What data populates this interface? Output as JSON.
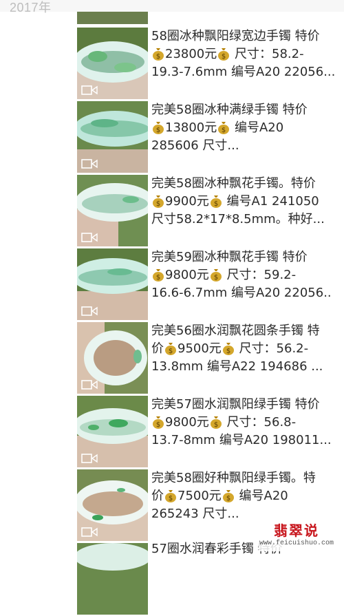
{
  "header": {
    "year": "2017年"
  },
  "colors": {
    "money_bag": "#c9a227",
    "bg": "#ffffff",
    "watermark_red": "#c8161d"
  },
  "posts": [
    {
      "l1": "58圈冰种飘阳绿宽边手镯 特价",
      "price": "23800元",
      "l2b": " 尺寸：58.2-",
      "l3": "19.3-7.6mm 编号A20 22056..."
    },
    {
      "l1": "完美58圈冰种满绿手镯 特价",
      "price": "13800元",
      "l2b": " 编号A20",
      "l3": "285606 尺寸..."
    },
    {
      "l1": "完美58圈冰种飘花手镯。特价",
      "price": "9900元",
      "l2b": " 编号A1 241050",
      "l3": "尺寸58.2*17*8.5mm。种好..."
    },
    {
      "l1": "完美59圈冰种飘花手镯 特价",
      "price": "9800元",
      "l2b": " 尺寸：59.2-",
      "l3": "16.6-6.7mm 编号A20 22056.."
    },
    {
      "l1": "完美56圈水润飘花圆条手镯 特",
      "l2a": "价",
      "price": "9500元",
      "l2b": " 尺寸：56.2-",
      "l3": "13.8mm 编号A22 194686 ..."
    },
    {
      "l1": "完美57圈水润飘阳绿手镯 特价",
      "price": "9800元",
      "l2b": " 尺寸：56.8-",
      "l3": "13.7-8mm 编号A20 198011..."
    },
    {
      "l1": "完美58圈好种飘阳绿手镯。特",
      "l2a": "价",
      "price": "7500元",
      "l2b": " 编号A20",
      "l3": "265243 尺寸..."
    },
    {
      "l1": "57圈水润春彩手镯 特价"
    }
  ],
  "watermark": {
    "title": "翡翠说",
    "url": "www.feicuishuo.com"
  }
}
